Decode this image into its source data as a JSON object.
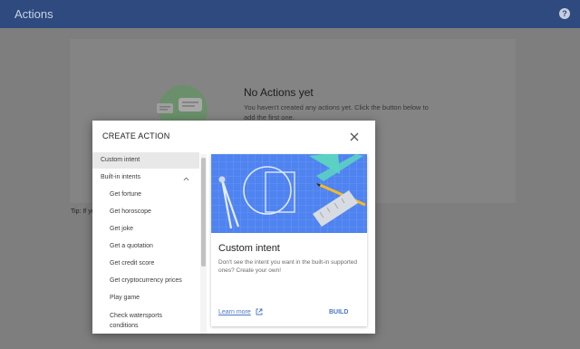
{
  "app": {
    "title": "Actions",
    "help_glyph": "?"
  },
  "empty_state": {
    "title": "No Actions yet",
    "text": "You haven't created any actions yet. Click the button below to add the first one."
  },
  "tip": {
    "text": "Tip: If yo"
  },
  "dialog": {
    "title": "CREATE ACTION",
    "items": {
      "custom": "Custom intent",
      "builtin": "Built-in intents",
      "fortune": "Get fortune",
      "horoscope": "Get horoscope",
      "joke": "Get joke",
      "quotation": "Get a quotation",
      "credit": "Get credit score",
      "crypto": "Get cryptocurrency prices",
      "game": "Play game",
      "water1": "Check watersports",
      "water2": "conditions"
    },
    "detail": {
      "title": "Custom intent",
      "description": "Don't see the intent you want in the built-in supported ones? Create your own!",
      "learn_more": "Learn more",
      "build": "BUILD"
    }
  },
  "colors": {
    "topbar": "#2e4a7f",
    "accent": "#4a76c4",
    "hero_blue": "#4f83f0",
    "hero_teal": "#5ad1c3",
    "pencil": "#f5b928"
  },
  "icons": [
    "help-icon",
    "close-icon",
    "chevron-up-icon",
    "open-in-new-icon",
    "chat-bubble-icon"
  ]
}
